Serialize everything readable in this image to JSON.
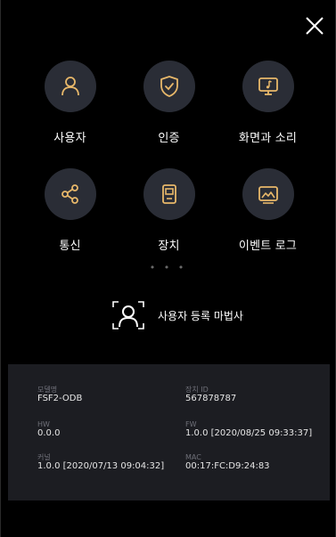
{
  "close_label": "",
  "menu": [
    {
      "label": "사용자",
      "icon": "user-icon"
    },
    {
      "label": "인증",
      "icon": "shield-check-icon"
    },
    {
      "label": "화면과 소리",
      "icon": "monitor-music-icon"
    },
    {
      "label": "통신",
      "icon": "share-icon"
    },
    {
      "label": "장치",
      "icon": "device-icon"
    },
    {
      "label": "이벤트 로그",
      "icon": "image-log-icon"
    }
  ],
  "dots": "• • •",
  "wizard": {
    "label": "사용자 등록 마법사",
    "icon": "user-scan-icon"
  },
  "info": {
    "model_key": "모델명",
    "model_val": "FSF2-ODB",
    "device_id_key": "장치 ID",
    "device_id_val": "567878787",
    "hw_key": "HW",
    "hw_val": "0.0.0",
    "fw_key": "FW",
    "fw_val": "1.0.0 [2020/08/25 09:33:37]",
    "kernel_key": "커널",
    "kernel_val": "1.0.0 [2020/07/13 09:04:32]",
    "mac_key": "MAC",
    "mac_val": "00:17:FC:D9:24:83"
  },
  "colors": {
    "accent": "#e8b86a",
    "tile": "#2a2d36",
    "panel": "#1c1d22"
  }
}
